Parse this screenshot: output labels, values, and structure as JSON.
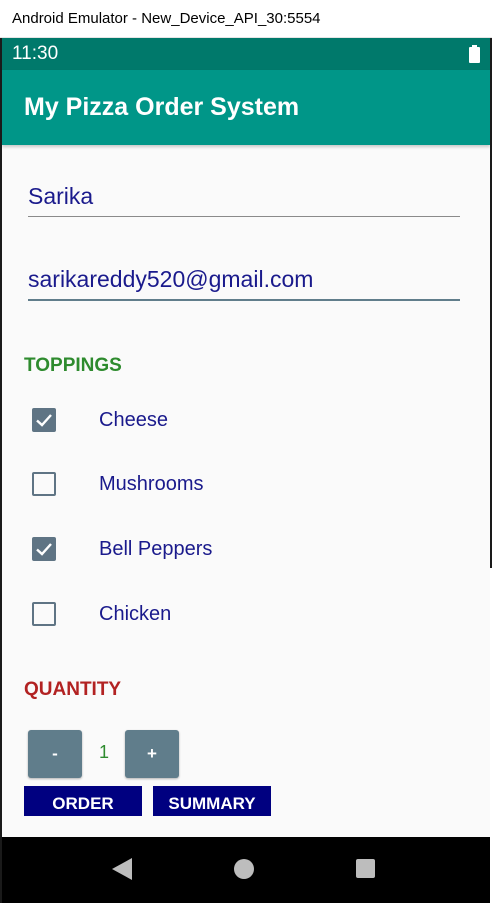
{
  "window": {
    "title": "Android Emulator - New_Device_API_30:5554"
  },
  "status_bar": {
    "time": "11:30",
    "battery_icon": "battery-full-icon"
  },
  "app_bar": {
    "title": "My Pizza Order System"
  },
  "form": {
    "name_value": "Sarika",
    "email_value": "sarikareddy520@gmail.com"
  },
  "toppings": {
    "heading": "TOPPINGS",
    "heading_color": "#2e8b2e",
    "items": [
      {
        "label": "Cheese",
        "checked": true
      },
      {
        "label": "Mushrooms",
        "checked": false
      },
      {
        "label": "Bell Peppers",
        "checked": true
      },
      {
        "label": "Chicken",
        "checked": false
      }
    ]
  },
  "quantity": {
    "heading": "QUANTITY",
    "heading_color": "#b22222",
    "minus_label": "-",
    "plus_label": "+",
    "value": "1",
    "value_color": "#2e8b2e"
  },
  "actions": {
    "order_label": "ORDER",
    "summary_label": "SUMMARY"
  },
  "colors": {
    "status_bar": "#00796b",
    "app_bar": "#009688",
    "button_grey": "#607d8b",
    "button_navy": "#000080",
    "text_navy": "#1a1a8c"
  },
  "nav_bar": {
    "back_icon": "back-triangle-icon",
    "home_icon": "home-circle-icon",
    "recent_icon": "recent-square-icon"
  }
}
